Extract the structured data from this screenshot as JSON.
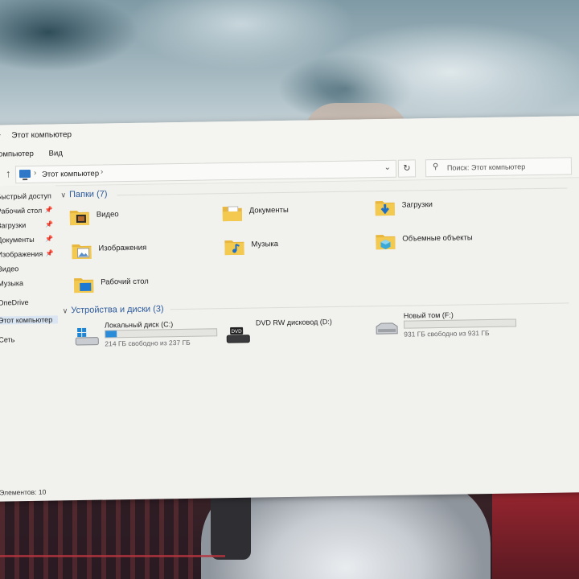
{
  "window": {
    "title": "Этот компьютер",
    "ribbon_tabs": [
      "Компьютер",
      "Вид"
    ]
  },
  "address": {
    "crumb": "Этот компьютер",
    "search_placeholder": "Поиск: Этот компьютер"
  },
  "nav": {
    "items": [
      {
        "label": "Быстрый доступ",
        "pinned": false
      },
      {
        "label": "Рабочий стол",
        "pinned": true
      },
      {
        "label": "Загрузки",
        "pinned": true
      },
      {
        "label": "Документы",
        "pinned": true
      },
      {
        "label": "Изображения",
        "pinned": true
      },
      {
        "label": "Видео",
        "pinned": false
      },
      {
        "label": "Музыка",
        "pinned": false
      },
      {
        "label": "OneDrive",
        "pinned": false
      },
      {
        "label": "Этот компьютер",
        "pinned": false,
        "selected": true
      },
      {
        "label": "Сеть",
        "pinned": false
      }
    ]
  },
  "folders_section": {
    "title": "Папки (7)",
    "items": [
      {
        "label": "Видео",
        "icon": "video-folder-icon"
      },
      {
        "label": "Документы",
        "icon": "documents-folder-icon"
      },
      {
        "label": "Загрузки",
        "icon": "downloads-folder-icon"
      },
      {
        "label": "Изображения",
        "icon": "pictures-folder-icon"
      },
      {
        "label": "Музыка",
        "icon": "music-folder-icon"
      },
      {
        "label": "Объемные объекты",
        "icon": "3d-objects-folder-icon"
      },
      {
        "label": "Рабочий стол",
        "icon": "desktop-folder-icon"
      }
    ]
  },
  "drives_section": {
    "title": "Устройства и диски (3)",
    "items": [
      {
        "name": "Локальный диск (C:)",
        "free_text": "214 ГБ свободно из 237 ГБ",
        "used_fraction": 0.1,
        "icon": "windows-drive-icon"
      },
      {
        "name": "DVD RW дисковод (D:)",
        "free_text": "",
        "used_fraction": null,
        "icon": "dvd-drive-icon"
      },
      {
        "name": "Новый том (F:)",
        "free_text": "931 ГБ свободно из 931 ГБ",
        "used_fraction": 0.0,
        "icon": "hdd-drive-icon"
      }
    ]
  },
  "status": {
    "text": "Элементов: 10"
  },
  "colors": {
    "accent": "#2a8bd8",
    "section_header": "#2c5a9c",
    "folder": "#f0c24b",
    "selection": "#d9e5f2"
  }
}
